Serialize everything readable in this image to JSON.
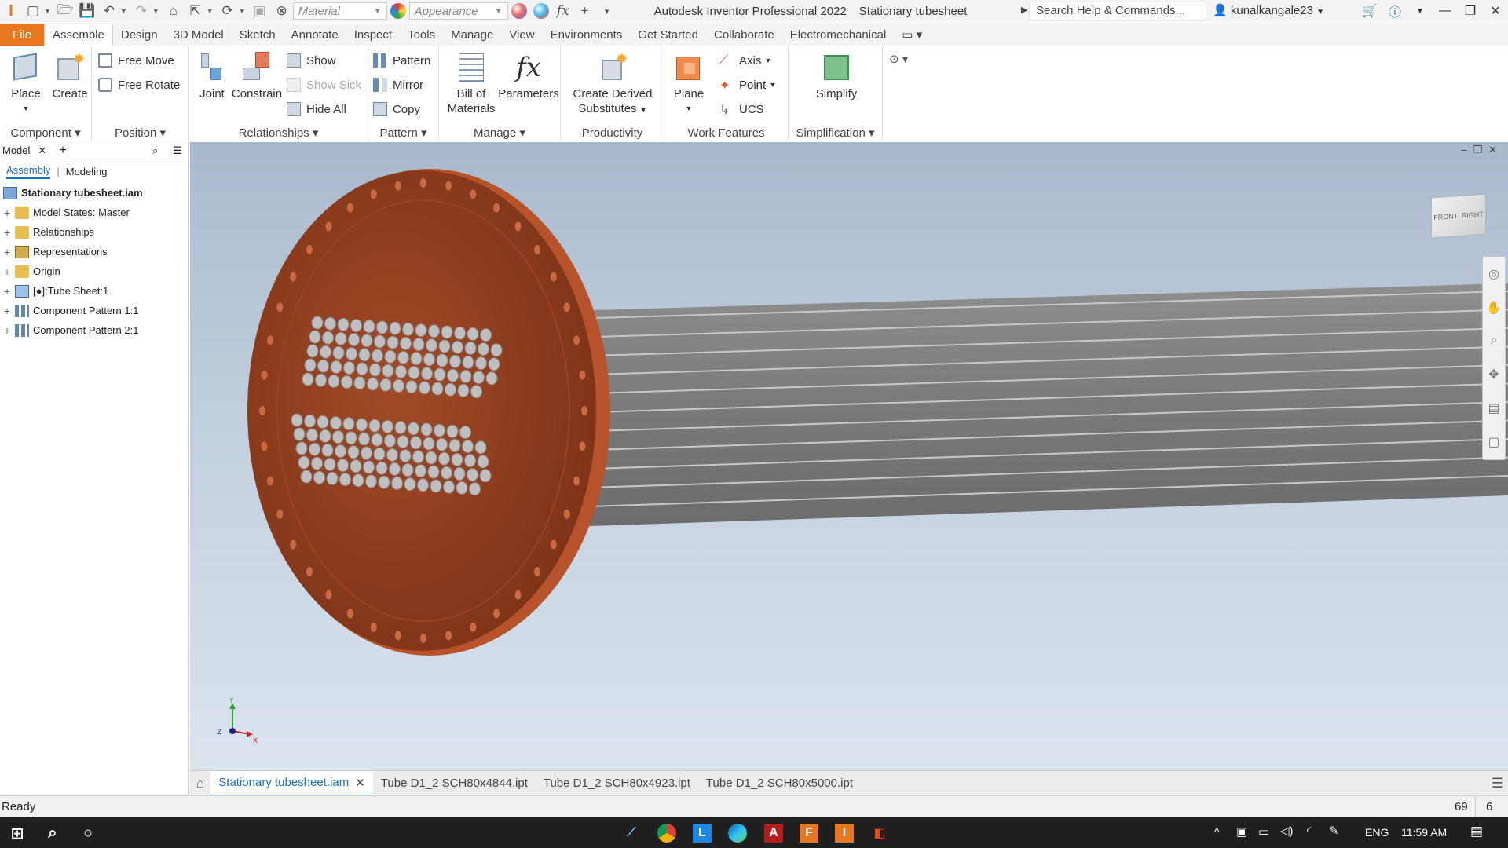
{
  "window": {
    "app_title": "Autodesk Inventor Professional 2022",
    "doc_title": "Stationary tubesheet",
    "search_placeholder": "Search Help & Commands...",
    "user": "kunalkangale23"
  },
  "quick_access": {
    "material": "Material",
    "appearance": "Appearance",
    "fx": "fx"
  },
  "tabs": [
    "Assemble",
    "Design",
    "3D Model",
    "Sketch",
    "Annotate",
    "Inspect",
    "Tools",
    "Manage",
    "View",
    "Environments",
    "Get Started",
    "Collaborate",
    "Electromechanical"
  ],
  "file_tab": "File",
  "ribbon": {
    "component": {
      "label": "Component",
      "place": "Place",
      "create": "Create"
    },
    "position": {
      "label": "Position",
      "free_move": "Free Move",
      "free_rotate": "Free Rotate"
    },
    "relationships": {
      "label": "Relationships",
      "joint": "Joint",
      "constrain": "Constrain",
      "show": "Show",
      "show_sick": "Show Sick",
      "hide_all": "Hide All"
    },
    "pattern": {
      "label": "Pattern",
      "pattern": "Pattern",
      "mirror": "Mirror",
      "copy": "Copy"
    },
    "manage": {
      "label": "Manage",
      "bom_1": "Bill of",
      "bom_2": "Materials",
      "parameters": "Parameters",
      "fx": "fx"
    },
    "productivity": {
      "label": "Productivity",
      "derived_1": "Create Derived",
      "derived_2": "Substitutes"
    },
    "work_features": {
      "label": "Work Features",
      "plane": "Plane",
      "axis": "Axis",
      "point": "Point",
      "ucs": "UCS"
    },
    "simplification": {
      "label": "Simplification",
      "simplify": "Simplify"
    }
  },
  "browser": {
    "tab": "Model",
    "sub_tabs": [
      "Assembly",
      "Modeling"
    ],
    "root": "Stationary tubesheet.iam",
    "items": [
      "Model States: Master",
      "Relationships",
      "Representations",
      "Origin",
      "[●]:Tube Sheet:1",
      "Component Pattern 1:1",
      "Component Pattern 2:1"
    ]
  },
  "viewcube": {
    "front": "FRONT",
    "right": "RIGHT"
  },
  "triad": {
    "x": "X",
    "y": "Y",
    "z": "Z"
  },
  "doc_tabs": [
    "Stationary tubesheet.iam",
    "Tube D1_2 SCH80x4844.ipt",
    "Tube D1_2 SCH80x4923.ipt",
    "Tube D1_2 SCH80x5000.ipt"
  ],
  "status": {
    "text": "Ready",
    "count1": "69",
    "count2": "6"
  },
  "taskbar": {
    "lang": "ENG",
    "time": "11:59 AM"
  },
  "colors": {
    "file_tab": "#e87722",
    "accent": "#1b6fbf",
    "flange": "#8c3b1c"
  }
}
